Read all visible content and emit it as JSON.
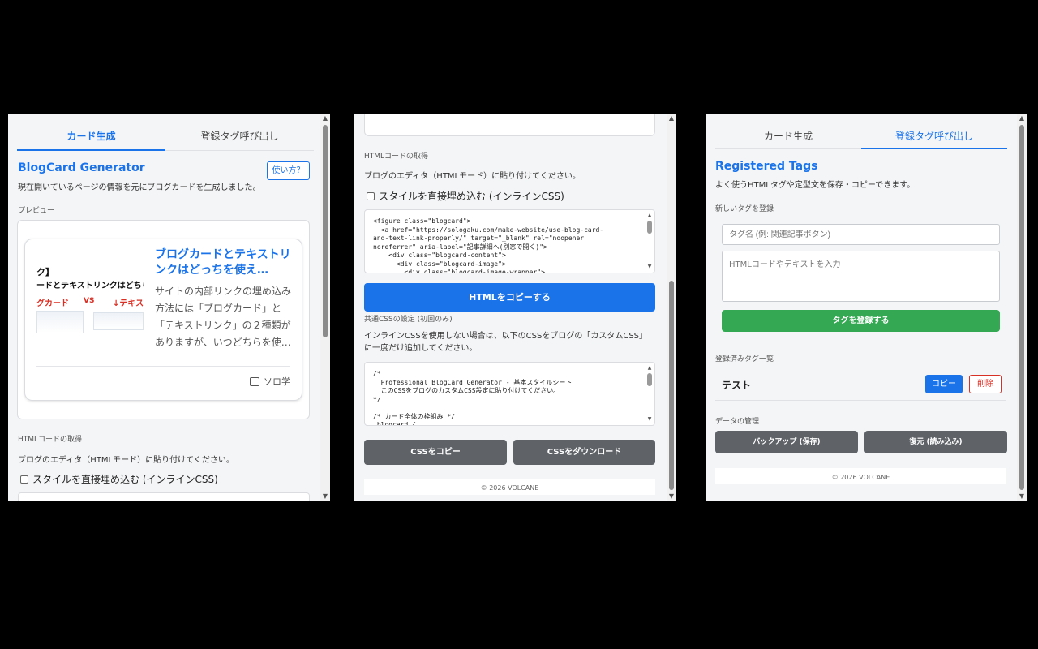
{
  "panel1": {
    "tabs": [
      "カード生成",
      "登録タグ呼び出し"
    ],
    "title": "BlogCard Generator",
    "help_button": "使い方？",
    "description": "現在開いているページの情報を元にブログカードを生成しました。",
    "preview_label": "プレビュー",
    "card": {
      "thumb_line1": "ク】",
      "thumb_line2": "ードとテキストリンクはどちら",
      "thumb_left": "グカード",
      "thumb_vs": "VS",
      "thumb_right": "↓テキス",
      "title": "ブログカードとテキストリンクはどっちを使え…",
      "excerpt": "サイトの内部リンクの埋め込み方法には「ブログカード」と「テキストリンク」の２種類がありますが、いつどちらを使…",
      "site": "ソロ学"
    },
    "html_section_label": "HTMLコードの取得",
    "html_instruction": "ブログのエディタ（HTMLモード）に貼り付けてください。",
    "inline_css_label": "スタイルを直接埋め込む (インラインCSS)"
  },
  "panel2": {
    "html_section_label": "HTMLコードの取得",
    "html_instruction": "ブログのエディタ（HTMLモード）に貼り付けてください。",
    "inline_css_label": "スタイルを直接埋め込む (インラインCSS)",
    "html_code": "<figure class=\"blogcard\">\n  <a href=\"https://sologaku.com/make-website/use-blog-card-\nand-text-link-properly/\" target=\"_blank\" rel=\"noopener\nnoreferrer\" aria-label=\"記事詳細へ(別窓で開く)\">\n    <div class=\"blogcard-content\">\n      <div class=\"blogcard-image\">\n        <div class=\"blogcard-image-wrapper\">",
    "copy_html_button": "HTMLをコピーする",
    "css_section_label": "共通CSSの設定 (初回のみ)",
    "css_instruction": "インラインCSSを使用しない場合は、以下のCSSをブログの「カスタムCSS」に一度だけ追加してください。",
    "css_code": "/*\n  Professional BlogCard Generator - 基本スタイルシート\n  このCSSをブログのカスタムCSS設定に貼り付けてください。\n*/\n\n/* カード全体の枠組み */\n.blogcard {",
    "copy_css_button": "CSSをコピー",
    "download_css_button": "CSSをダウンロード",
    "footer": "© 2026 VOLCANE"
  },
  "panel3": {
    "tabs": [
      "カード生成",
      "登録タグ呼び出し"
    ],
    "title": "Registered Tags",
    "description": "よく使うHTMLタグや定型文を保存・コピーできます。",
    "new_tag_label": "新しいタグを登録",
    "tag_name_placeholder": "タグ名 (例: 関連記事ボタン)",
    "tag_body_placeholder": "HTMLコードやテキストを入力",
    "register_button": "タグを登録する",
    "list_label": "登録済みタグ一覧",
    "tags": [
      {
        "name": "テスト",
        "copy": "コピー",
        "delete": "削除"
      }
    ],
    "data_label": "データの管理",
    "backup_button": "バックアップ (保存)",
    "restore_button": "復元 (読み込み)",
    "footer": "© 2026 VOLCANE"
  },
  "colors": {
    "accent": "#1a73e8",
    "green": "#34a853",
    "danger": "#d93025",
    "gray_button": "#5f6368"
  }
}
